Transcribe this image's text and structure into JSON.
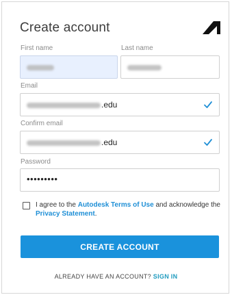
{
  "header": {
    "title": "Create account",
    "logo_icon": "autodesk-logo-icon"
  },
  "form": {
    "first_name": {
      "label": "First name",
      "value_obscured": true
    },
    "last_name": {
      "label": "Last name",
      "value_obscured": true
    },
    "email": {
      "label": "Email",
      "visible_suffix": ".edu",
      "valid": true
    },
    "confirm_email": {
      "label": "Confirm email",
      "visible_suffix": ".edu",
      "valid": true
    },
    "password": {
      "label": "Password",
      "masked_value": "•••••••••"
    }
  },
  "terms": {
    "text_before": "I agree to the ",
    "terms_link": "Autodesk Terms of Use",
    "text_middle": " and acknowledge the ",
    "privacy_link": "Privacy Statement",
    "text_after": ".",
    "checked": false
  },
  "actions": {
    "create_label": "CREATE ACCOUNT",
    "signin_prompt": "ALREADY HAVE AN ACCOUNT? ",
    "signin_link": "SIGN IN"
  },
  "colors": {
    "accent": "#1a92dc",
    "link": "#1f8fd6",
    "valid_check": "#1f8fd6",
    "autofill_bg": "#e8f0fe"
  }
}
